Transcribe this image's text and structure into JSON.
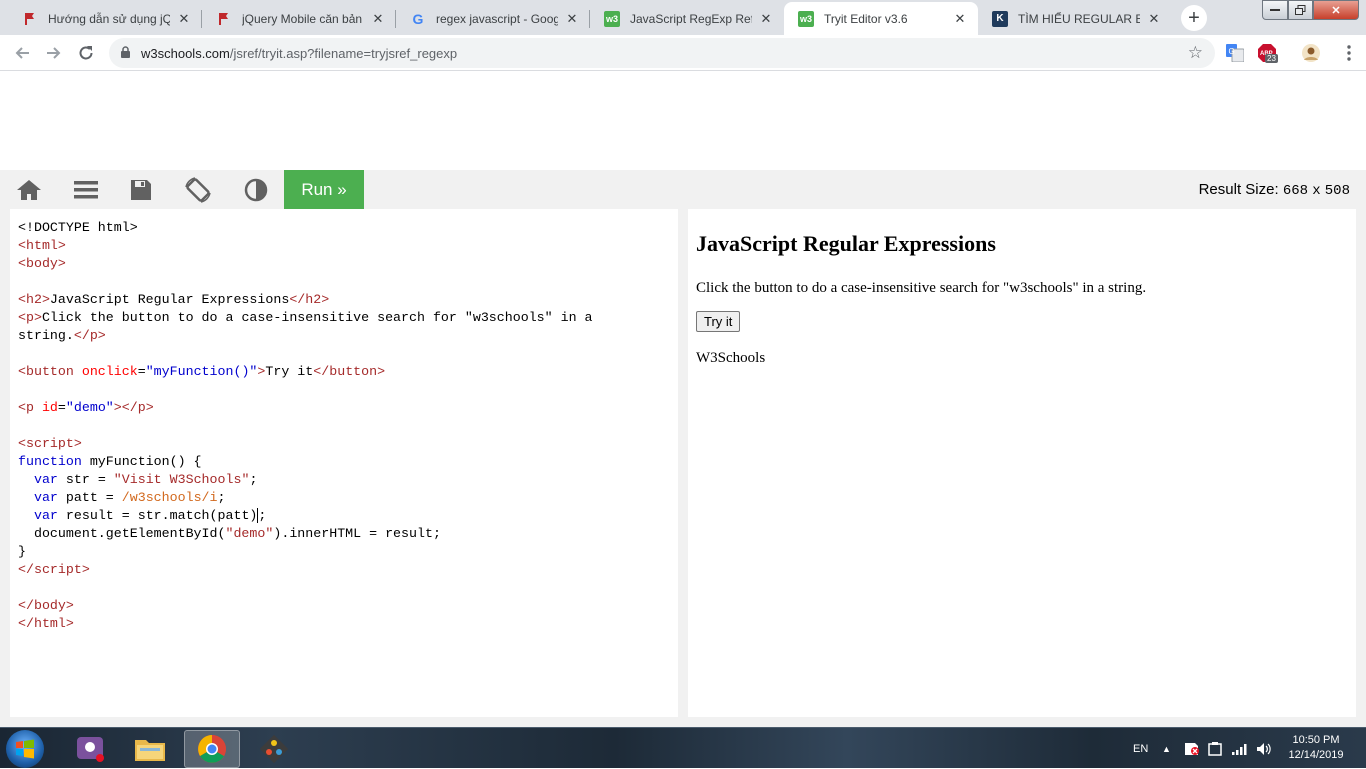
{
  "browser": {
    "tabs": [
      {
        "title": "Hướng dẫn sử dụng jQu",
        "favicon": "red-flag-icon",
        "active": false
      },
      {
        "title": "jQuery Mobile căn bản",
        "favicon": "red-flag-icon",
        "active": false
      },
      {
        "title": "regex javascript - Googl",
        "favicon": "google-icon",
        "active": false
      },
      {
        "title": "JavaScript RegExp Refer",
        "favicon": "w3schools-icon",
        "active": false
      },
      {
        "title": "Tryit Editor v3.6",
        "favicon": "w3schools-icon",
        "active": true
      },
      {
        "title": "TÌM HIỂU REGULAR EXP",
        "favicon": "k-icon",
        "active": false
      }
    ],
    "url_host": "w3schools.com",
    "url_path": "/jsref/tryit.asp?filename=tryjsref_regexp",
    "extension_badge": "23",
    "colors": {
      "accent": "#4caf50",
      "tab_strip": "#dee1e6"
    }
  },
  "tryit": {
    "run_label": "Run »",
    "result_size_label": "Result Size:",
    "result_width": "668",
    "result_x": "x",
    "result_height": "508"
  },
  "result": {
    "heading": "JavaScript Regular Expressions",
    "paragraph": "Click the button to do a case-insensitive search for \"w3schools\" in a string.",
    "button_label": "Try it",
    "demo_output": "W3Schools"
  },
  "taskbar": {
    "language": "EN",
    "time": "10:50 PM",
    "date": "12/14/2019"
  }
}
